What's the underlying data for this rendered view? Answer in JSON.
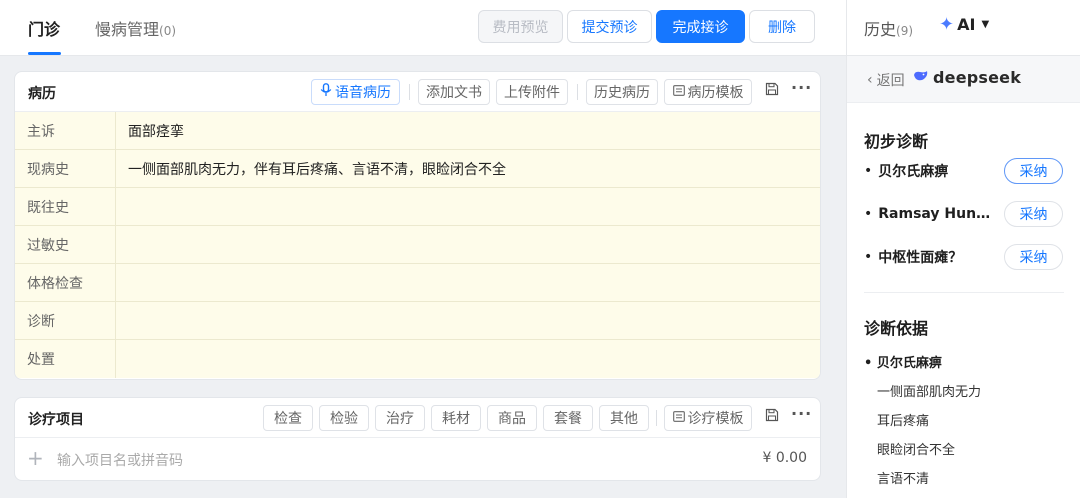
{
  "tabs": [
    {
      "label": "门诊",
      "count": ""
    },
    {
      "label": "慢病管理",
      "count": "(0)"
    }
  ],
  "actions": {
    "fee_preview": "费用预览",
    "submit_prediagnosis": "提交预诊",
    "finish_visit": "完成接诊",
    "delete": "删除"
  },
  "record": {
    "title": "病历",
    "toolbar": {
      "voice": "语音病历",
      "add_doc": "添加文书",
      "upload": "上传附件",
      "history": "历史病历",
      "template": "病历模板"
    },
    "rows": [
      {
        "label": "主诉",
        "value": "面部痉挛"
      },
      {
        "label": "现病史",
        "value": "一侧面部肌肉无力，伴有耳后疼痛、言语不清，眼睑闭合不全"
      },
      {
        "label": "既往史",
        "value": ""
      },
      {
        "label": "过敏史",
        "value": ""
      },
      {
        "label": "体格检查",
        "value": ""
      },
      {
        "label": "诊断",
        "value": ""
      },
      {
        "label": "处置",
        "value": ""
      }
    ]
  },
  "treatment": {
    "title": "诊疗项目",
    "filters": [
      "检查",
      "检验",
      "治疗",
      "耗材",
      "商品",
      "套餐",
      "其他"
    ],
    "template": "诊疗模板",
    "input_placeholder": "输入项目名或拼音码",
    "price": "¥ 0.00"
  },
  "right_panel": {
    "history_label": "历史",
    "history_count": "(9)",
    "ai_label": "AI",
    "back_label": "返回",
    "brand": "deepseek",
    "prelim_title": "初步诊断",
    "diagnoses": [
      {
        "name": "贝尔氏麻痹",
        "action": "采纳"
      },
      {
        "name": "Ramsay Hunt…",
        "action": "采纳"
      },
      {
        "name": "中枢性面瘫？",
        "action": "采纳"
      }
    ],
    "basis_title": "诊断依据",
    "basis_heading": "贝尔氏麻痹",
    "basis_items": [
      "一侧面部肌肉无力",
      "耳后疼痛",
      "眼睑闭合不全",
      "言语不清"
    ]
  },
  "colors": {
    "accent": "#1677ff",
    "row_bg": "#fefcea",
    "deepseek": "#4d6bfe"
  }
}
